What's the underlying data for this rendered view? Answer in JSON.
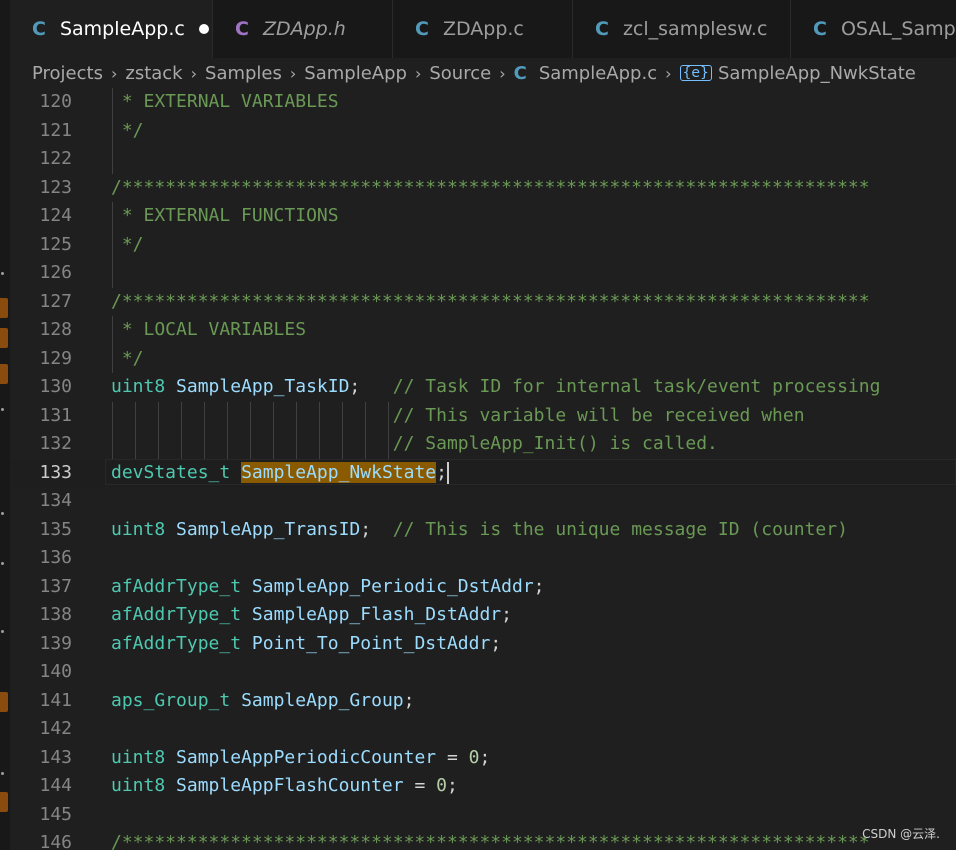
{
  "tabs": [
    {
      "icon": "C",
      "label": "SampleApp.c",
      "active": true,
      "modified": true,
      "italic": false
    },
    {
      "icon": "C",
      "label": "ZDApp.h",
      "active": false,
      "modified": false,
      "italic": true
    },
    {
      "icon": "C",
      "label": "ZDApp.c",
      "active": false,
      "modified": false,
      "italic": false
    },
    {
      "icon": "C",
      "label": "zcl_samplesw.c",
      "active": false,
      "modified": false,
      "italic": false
    },
    {
      "icon": "C",
      "label": "OSAL_SampleApp.c",
      "active": false,
      "modified": false,
      "italic": false
    }
  ],
  "breadcrumb": {
    "items": [
      "Projects",
      "zstack",
      "Samples",
      "SampleApp",
      "Source"
    ],
    "file_icon": "C",
    "file": "SampleApp.c",
    "symbol_icon": "{e}",
    "symbol": "SampleApp_NwkState"
  },
  "lines": [
    {
      "n": "120",
      "tokens": [
        [
          " * EXTERNAL VARIABLES",
          "cm"
        ]
      ]
    },
    {
      "n": "121",
      "tokens": [
        [
          " */",
          "cm"
        ]
      ]
    },
    {
      "n": "122",
      "tokens": []
    },
    {
      "n": "123",
      "tokens": [
        [
          "/*********************************************************************",
          "cm"
        ]
      ]
    },
    {
      "n": "124",
      "tokens": [
        [
          " * EXTERNAL FUNCTIONS",
          "cm"
        ]
      ]
    },
    {
      "n": "125",
      "tokens": [
        [
          " */",
          "cm"
        ]
      ]
    },
    {
      "n": "126",
      "tokens": []
    },
    {
      "n": "127",
      "tokens": [
        [
          "/*********************************************************************",
          "cm"
        ]
      ]
    },
    {
      "n": "128",
      "tokens": [
        [
          " * LOCAL VARIABLES",
          "cm"
        ]
      ]
    },
    {
      "n": "129",
      "tokens": [
        [
          " */",
          "cm"
        ]
      ]
    },
    {
      "n": "130",
      "tokens": [
        [
          "uint8",
          "ty"
        ],
        [
          " ",
          "pn"
        ],
        [
          "SampleApp_TaskID",
          "id"
        ],
        [
          ";   ",
          "pn"
        ],
        [
          "// Task ID for internal task/event processing",
          "cm"
        ]
      ]
    },
    {
      "n": "131",
      "tokens": [
        [
          "                          ",
          "pn"
        ],
        [
          "// This variable will be received when",
          "cm"
        ]
      ]
    },
    {
      "n": "132",
      "tokens": [
        [
          "                          ",
          "pn"
        ],
        [
          "// SampleApp_Init() is called.",
          "cm"
        ]
      ]
    },
    {
      "n": "133",
      "current": true,
      "tokens": [
        [
          "devStates_t",
          "ty"
        ],
        [
          " ",
          "pn"
        ],
        [
          "SampleApp_NwkState",
          "hl"
        ],
        [
          ";",
          "pn"
        ],
        [
          "",
          "caret"
        ]
      ]
    },
    {
      "n": "134",
      "tokens": []
    },
    {
      "n": "135",
      "tokens": [
        [
          "uint8",
          "ty"
        ],
        [
          " ",
          "pn"
        ],
        [
          "SampleApp_TransID",
          "id"
        ],
        [
          ";  ",
          "pn"
        ],
        [
          "// This is the unique message ID (counter)",
          "cm"
        ]
      ]
    },
    {
      "n": "136",
      "tokens": []
    },
    {
      "n": "137",
      "tokens": [
        [
          "afAddrType_t",
          "ty"
        ],
        [
          " ",
          "pn"
        ],
        [
          "SampleApp_Periodic_DstAddr",
          "id"
        ],
        [
          ";",
          "pn"
        ]
      ]
    },
    {
      "n": "138",
      "tokens": [
        [
          "afAddrType_t",
          "ty"
        ],
        [
          " ",
          "pn"
        ],
        [
          "SampleApp_Flash_DstAddr",
          "id"
        ],
        [
          ";",
          "pn"
        ]
      ]
    },
    {
      "n": "139",
      "tokens": [
        [
          "afAddrType_t",
          "ty"
        ],
        [
          " ",
          "pn"
        ],
        [
          "Point_To_Point_DstAddr",
          "id"
        ],
        [
          ";",
          "pn"
        ]
      ]
    },
    {
      "n": "140",
      "tokens": []
    },
    {
      "n": "141",
      "tokens": [
        [
          "aps_Group_t",
          "ty"
        ],
        [
          " ",
          "pn"
        ],
        [
          "SampleApp_Group",
          "id"
        ],
        [
          ";",
          "pn"
        ]
      ]
    },
    {
      "n": "142",
      "tokens": []
    },
    {
      "n": "143",
      "tokens": [
        [
          "uint8",
          "ty"
        ],
        [
          " ",
          "pn"
        ],
        [
          "SampleAppPeriodicCounter",
          "id"
        ],
        [
          " = ",
          "pn"
        ],
        [
          "0",
          "nm"
        ],
        [
          ";",
          "pn"
        ]
      ]
    },
    {
      "n": "144",
      "tokens": [
        [
          "uint8",
          "ty"
        ],
        [
          " ",
          "pn"
        ],
        [
          "SampleAppFlashCounter",
          "id"
        ],
        [
          " = ",
          "pn"
        ],
        [
          "0",
          "nm"
        ],
        [
          ";",
          "pn"
        ]
      ]
    },
    {
      "n": "145",
      "tokens": []
    },
    {
      "n": "146",
      "tokens": [
        [
          "/*********************************************************************",
          "cm"
        ]
      ]
    }
  ],
  "watermark": "CSDN @云泽."
}
